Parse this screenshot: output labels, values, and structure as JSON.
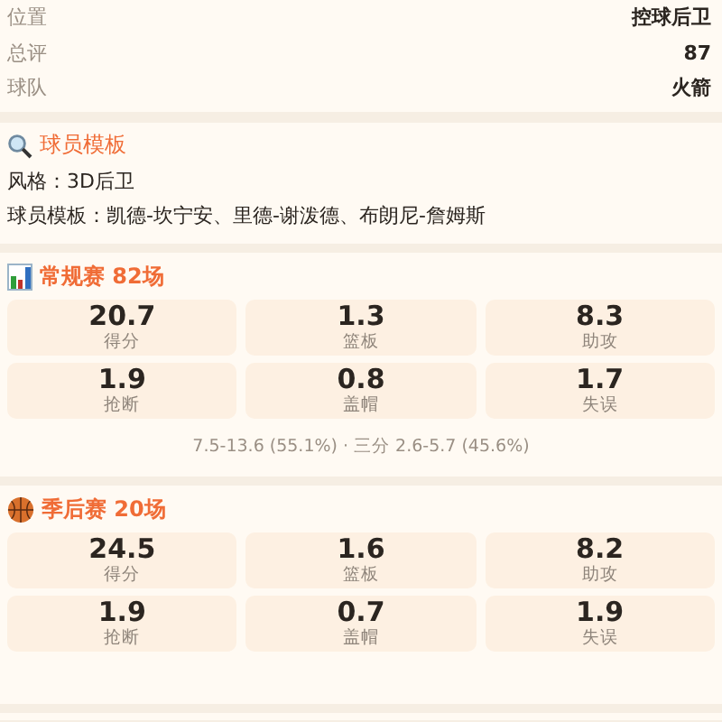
{
  "info_rows": [
    {
      "label": "位置",
      "value": "控球后卫"
    },
    {
      "label": "总评",
      "value": "87"
    },
    {
      "label": "球队",
      "value": "火箭"
    }
  ],
  "template_section": {
    "title": "球员模板",
    "lines": [
      "风格：3D后卫",
      "球员模板：凯德-坎宁安、里德-谢泼德、布朗尼-詹姆斯"
    ]
  },
  "stat_sections": [
    {
      "kind": "chart",
      "title": "常规赛 82场",
      "stats": [
        {
          "value": "20.7",
          "label": "得分"
        },
        {
          "value": "1.3",
          "label": "篮板"
        },
        {
          "value": "8.3",
          "label": "助攻"
        },
        {
          "value": "1.9",
          "label": "抢断"
        },
        {
          "value": "0.8",
          "label": "盖帽"
        },
        {
          "value": "1.7",
          "label": "失误"
        }
      ],
      "summary": "7.5-13.6 (55.1%) · 三分 2.6-5.7 (45.6%)"
    },
    {
      "kind": "ball",
      "title": "季后赛 20场",
      "stats": [
        {
          "value": "24.5",
          "label": "得分"
        },
        {
          "value": "1.6",
          "label": "篮板"
        },
        {
          "value": "8.2",
          "label": "助攻"
        },
        {
          "value": "1.9",
          "label": "抢断"
        },
        {
          "value": "0.7",
          "label": "盖帽"
        },
        {
          "value": "1.9",
          "label": "失误"
        }
      ]
    }
  ]
}
